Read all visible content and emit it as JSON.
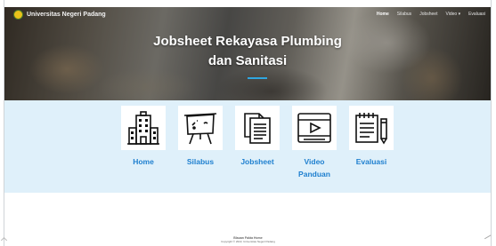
{
  "header": {
    "brand": "Universitas Negeri Padang",
    "nav": [
      "Home",
      "Silabus",
      "Jobsheet",
      "Video",
      "Evaluasi"
    ],
    "active_nav": "Home"
  },
  "hero": {
    "title_line1": "Jobsheet Rekayasa Plumbing",
    "title_line2": "dan Sanitasi",
    "accent_color": "#2fa6e0"
  },
  "menu": {
    "items": [
      {
        "label": "Home",
        "icon": "building-icon"
      },
      {
        "label": "Silabus",
        "icon": "easel-board-icon"
      },
      {
        "label": "Jobsheet",
        "icon": "documents-icon"
      },
      {
        "label": "Video Panduan",
        "icon": "video-player-icon"
      },
      {
        "label": "Evaluasi",
        "icon": "notepad-pencil-icon"
      }
    ],
    "label_color": "#1e7fcf",
    "band_color": "#dff0fa"
  },
  "footer": {
    "line1": "Blauan Fakta Home",
    "line2": "Copyright © 2022, Universitas Negeri Padang"
  }
}
